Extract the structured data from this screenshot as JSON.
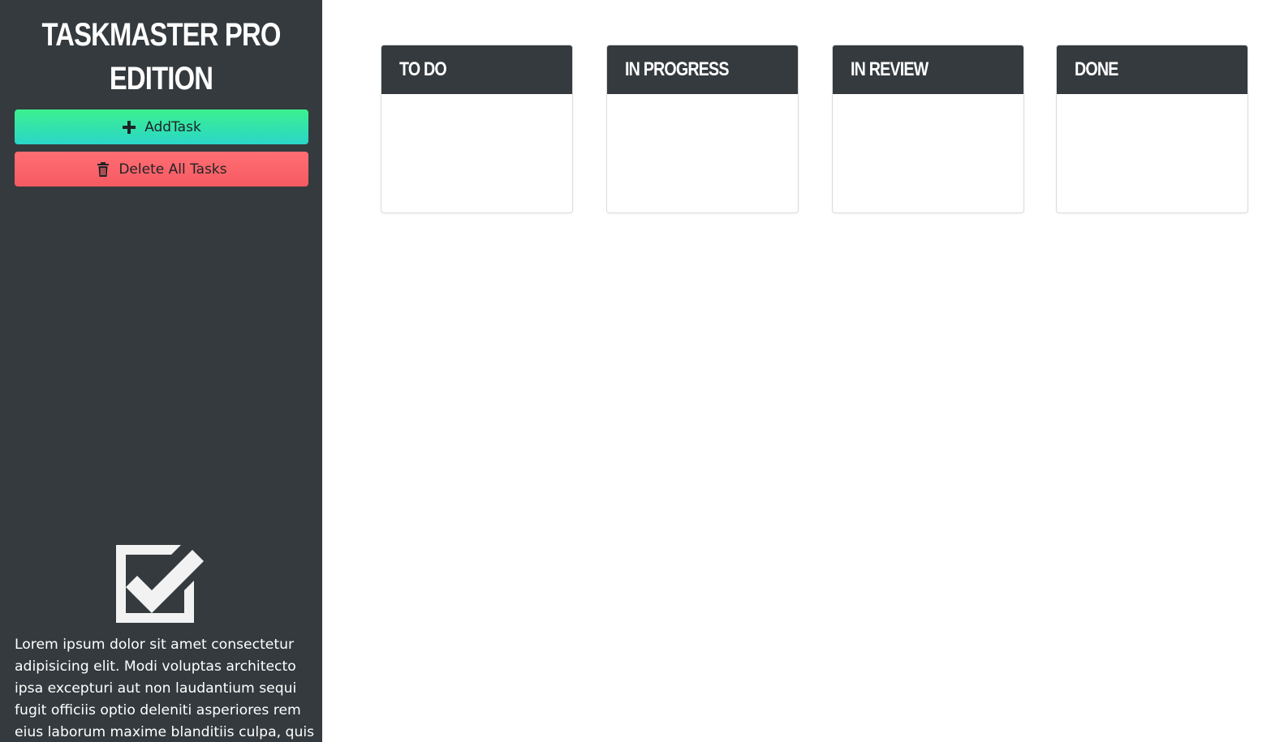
{
  "app": {
    "title": "TASKMASTER PRO EDITION"
  },
  "sidebar": {
    "add_task_label": "AddTask",
    "add_task_icon": "plus-icon",
    "delete_all_label": "Delete All Tasks",
    "delete_all_icon": "trash-icon",
    "logo_icon": "checkbox-checked-icon",
    "description": "Lorem ipsum dolor sit amet consectetur adipisicing elit. Modi voluptas architecto ipsa excepturi aut non laudantium sequi fugit officiis optio deleniti asperiores rem eius laborum maxime blanditiis culpa, quis"
  },
  "board": {
    "columns": [
      {
        "title": "TO DO",
        "tasks": []
      },
      {
        "title": "IN PROGRESS",
        "tasks": []
      },
      {
        "title": "IN REVIEW",
        "tasks": []
      },
      {
        "title": "DONE",
        "tasks": []
      }
    ]
  },
  "colors": {
    "sidebar_bg": "#343a3e",
    "add_button": "#2fe3a8",
    "delete_button": "#f9636a",
    "column_header_bg": "#343a3e"
  }
}
